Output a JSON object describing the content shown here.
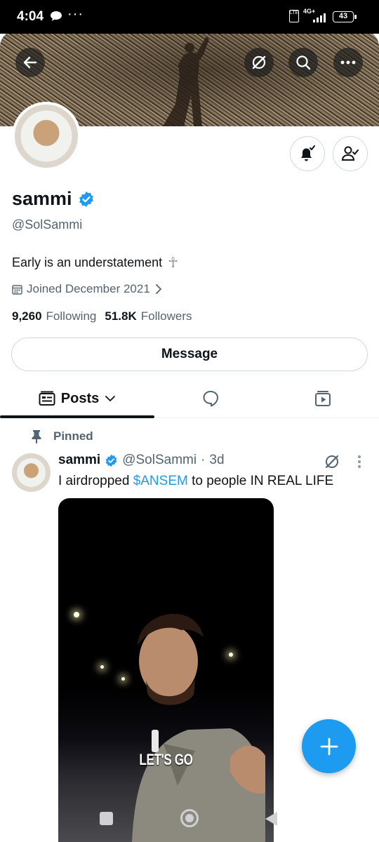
{
  "statusbar": {
    "time": "4:04",
    "dots": "···",
    "network": "LTE",
    "network_type": "4G+",
    "battery": "43"
  },
  "banner": {
    "back_icon": "back-arrow-icon",
    "grok_icon": "grok-icon",
    "search_icon": "search-icon",
    "more_icon": "more-horizontal-icon"
  },
  "profile": {
    "name": "sammi",
    "handle": "@SolSammi",
    "bio": "Early is an understatement",
    "bio_emoji": "☥",
    "joined": "Joined December 2021",
    "following_count": "9,260",
    "following_label": "Following",
    "followers_count": "51.8K",
    "followers_label": "Followers",
    "message_label": "Message"
  },
  "tabs": {
    "posts_label": "Posts"
  },
  "post": {
    "pinned_label": "Pinned",
    "name": "sammi",
    "handle": "@SolSammi",
    "separator": "·",
    "age": "3d",
    "text_before": "I airdropped ",
    "cashtag": "$ANSEM",
    "text_after": " to people IN REAL LIFE",
    "video_caption": "LET'S GO"
  },
  "colors": {
    "accent": "#1d9bf0",
    "secondary_text": "#536471",
    "border": "#cfd9de"
  }
}
